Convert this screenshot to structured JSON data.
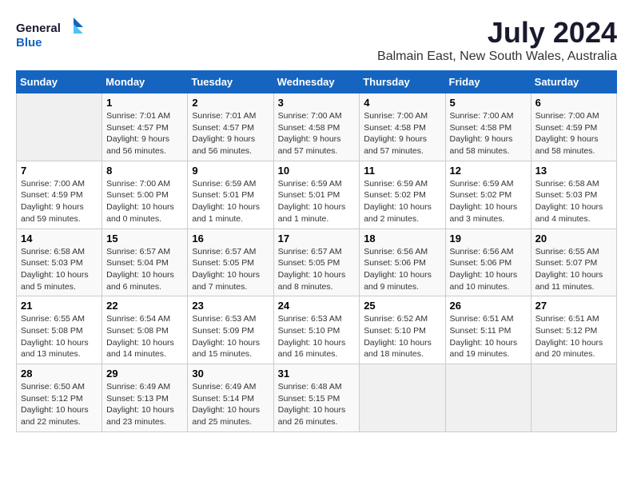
{
  "header": {
    "logo_line1": "General",
    "logo_line2": "Blue",
    "month": "July 2024",
    "location": "Balmain East, New South Wales, Australia"
  },
  "weekdays": [
    "Sunday",
    "Monday",
    "Tuesday",
    "Wednesday",
    "Thursday",
    "Friday",
    "Saturday"
  ],
  "weeks": [
    [
      {
        "day": "",
        "info": ""
      },
      {
        "day": "1",
        "info": "Sunrise: 7:01 AM\nSunset: 4:57 PM\nDaylight: 9 hours\nand 56 minutes."
      },
      {
        "day": "2",
        "info": "Sunrise: 7:01 AM\nSunset: 4:57 PM\nDaylight: 9 hours\nand 56 minutes."
      },
      {
        "day": "3",
        "info": "Sunrise: 7:00 AM\nSunset: 4:58 PM\nDaylight: 9 hours\nand 57 minutes."
      },
      {
        "day": "4",
        "info": "Sunrise: 7:00 AM\nSunset: 4:58 PM\nDaylight: 9 hours\nand 57 minutes."
      },
      {
        "day": "5",
        "info": "Sunrise: 7:00 AM\nSunset: 4:58 PM\nDaylight: 9 hours\nand 58 minutes."
      },
      {
        "day": "6",
        "info": "Sunrise: 7:00 AM\nSunset: 4:59 PM\nDaylight: 9 hours\nand 58 minutes."
      }
    ],
    [
      {
        "day": "7",
        "info": "Sunrise: 7:00 AM\nSunset: 4:59 PM\nDaylight: 9 hours\nand 59 minutes."
      },
      {
        "day": "8",
        "info": "Sunrise: 7:00 AM\nSunset: 5:00 PM\nDaylight: 10 hours\nand 0 minutes."
      },
      {
        "day": "9",
        "info": "Sunrise: 6:59 AM\nSunset: 5:01 PM\nDaylight: 10 hours\nand 1 minute."
      },
      {
        "day": "10",
        "info": "Sunrise: 6:59 AM\nSunset: 5:01 PM\nDaylight: 10 hours\nand 1 minute."
      },
      {
        "day": "11",
        "info": "Sunrise: 6:59 AM\nSunset: 5:02 PM\nDaylight: 10 hours\nand 2 minutes."
      },
      {
        "day": "12",
        "info": "Sunrise: 6:59 AM\nSunset: 5:02 PM\nDaylight: 10 hours\nand 3 minutes."
      },
      {
        "day": "13",
        "info": "Sunrise: 6:58 AM\nSunset: 5:03 PM\nDaylight: 10 hours\nand 4 minutes."
      }
    ],
    [
      {
        "day": "14",
        "info": "Sunrise: 6:58 AM\nSunset: 5:03 PM\nDaylight: 10 hours\nand 5 minutes."
      },
      {
        "day": "15",
        "info": "Sunrise: 6:57 AM\nSunset: 5:04 PM\nDaylight: 10 hours\nand 6 minutes."
      },
      {
        "day": "16",
        "info": "Sunrise: 6:57 AM\nSunset: 5:05 PM\nDaylight: 10 hours\nand 7 minutes."
      },
      {
        "day": "17",
        "info": "Sunrise: 6:57 AM\nSunset: 5:05 PM\nDaylight: 10 hours\nand 8 minutes."
      },
      {
        "day": "18",
        "info": "Sunrise: 6:56 AM\nSunset: 5:06 PM\nDaylight: 10 hours\nand 9 minutes."
      },
      {
        "day": "19",
        "info": "Sunrise: 6:56 AM\nSunset: 5:06 PM\nDaylight: 10 hours\nand 10 minutes."
      },
      {
        "day": "20",
        "info": "Sunrise: 6:55 AM\nSunset: 5:07 PM\nDaylight: 10 hours\nand 11 minutes."
      }
    ],
    [
      {
        "day": "21",
        "info": "Sunrise: 6:55 AM\nSunset: 5:08 PM\nDaylight: 10 hours\nand 13 minutes."
      },
      {
        "day": "22",
        "info": "Sunrise: 6:54 AM\nSunset: 5:08 PM\nDaylight: 10 hours\nand 14 minutes."
      },
      {
        "day": "23",
        "info": "Sunrise: 6:53 AM\nSunset: 5:09 PM\nDaylight: 10 hours\nand 15 minutes."
      },
      {
        "day": "24",
        "info": "Sunrise: 6:53 AM\nSunset: 5:10 PM\nDaylight: 10 hours\nand 16 minutes."
      },
      {
        "day": "25",
        "info": "Sunrise: 6:52 AM\nSunset: 5:10 PM\nDaylight: 10 hours\nand 18 minutes."
      },
      {
        "day": "26",
        "info": "Sunrise: 6:51 AM\nSunset: 5:11 PM\nDaylight: 10 hours\nand 19 minutes."
      },
      {
        "day": "27",
        "info": "Sunrise: 6:51 AM\nSunset: 5:12 PM\nDaylight: 10 hours\nand 20 minutes."
      }
    ],
    [
      {
        "day": "28",
        "info": "Sunrise: 6:50 AM\nSunset: 5:12 PM\nDaylight: 10 hours\nand 22 minutes."
      },
      {
        "day": "29",
        "info": "Sunrise: 6:49 AM\nSunset: 5:13 PM\nDaylight: 10 hours\nand 23 minutes."
      },
      {
        "day": "30",
        "info": "Sunrise: 6:49 AM\nSunset: 5:14 PM\nDaylight: 10 hours\nand 25 minutes."
      },
      {
        "day": "31",
        "info": "Sunrise: 6:48 AM\nSunset: 5:15 PM\nDaylight: 10 hours\nand 26 minutes."
      },
      {
        "day": "",
        "info": ""
      },
      {
        "day": "",
        "info": ""
      },
      {
        "day": "",
        "info": ""
      }
    ]
  ]
}
